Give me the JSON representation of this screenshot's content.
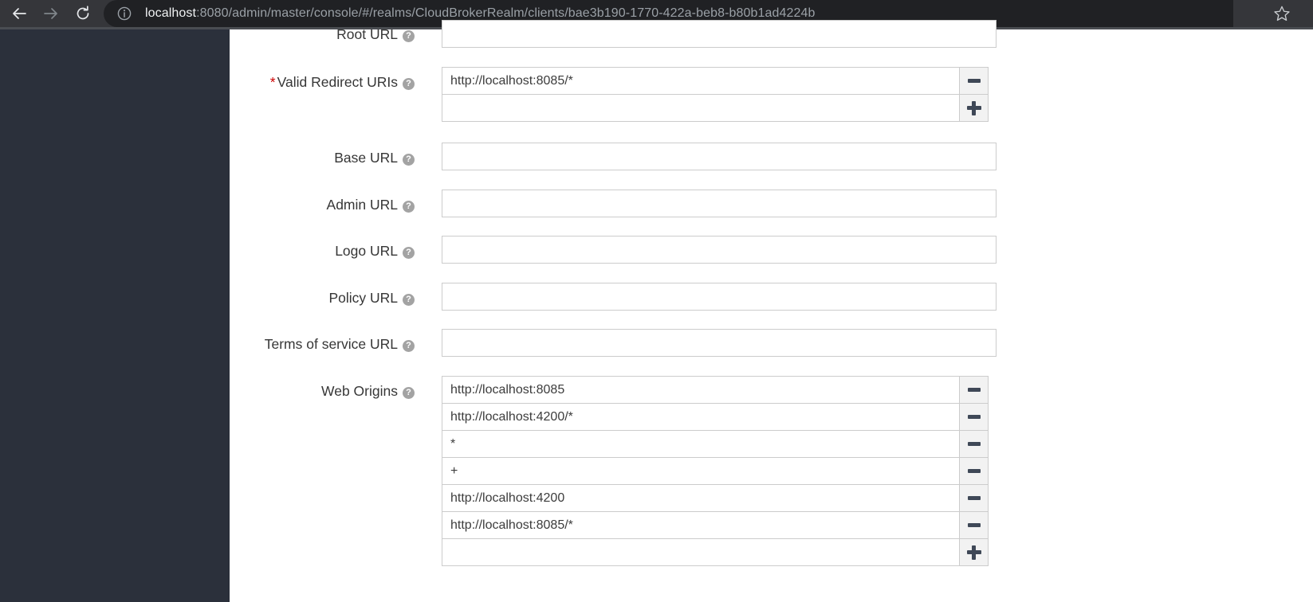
{
  "browser": {
    "back_icon": "back-arrow-icon",
    "forward_icon": "forward-arrow-icon",
    "reload_icon": "reload-icon",
    "info_icon": "info-circle-icon",
    "star_icon": "star-bookmark-icon",
    "url_host": "localhost",
    "url_rest": ":8080/admin/master/console/#/realms/CloudBrokerRealm/clients/bae3b190-1770-422a-beb8-b80b1ad4224b",
    "chrome_bg": "#35363a",
    "omnibox_bg": "#202124"
  },
  "theme": {
    "sidebar_bg": "#2b303b",
    "content_bg": "#ffffff",
    "label_color": "#363636",
    "required_color": "#cc0000",
    "input_border": "#cccccc",
    "button_bg": "#f2f2f2",
    "glyph_color": "#3f4857"
  },
  "form": {
    "help_glyph": "?",
    "required_glyph": "*",
    "minus_glyph": "minus-icon",
    "plus_glyph": "plus-icon",
    "fields": [
      {
        "id": "root-url",
        "label": "Root URL",
        "required": false,
        "type": "single",
        "value": "",
        "clipped": true
      },
      {
        "id": "valid-redirect-uris",
        "label": "Valid Redirect URIs",
        "required": true,
        "type": "multi",
        "values": [
          "http://localhost:8085/*",
          ""
        ]
      },
      {
        "id": "base-url",
        "label": "Base URL",
        "required": false,
        "type": "single",
        "value": ""
      },
      {
        "id": "admin-url",
        "label": "Admin URL",
        "required": false,
        "type": "single",
        "value": ""
      },
      {
        "id": "logo-url",
        "label": "Logo URL",
        "required": false,
        "type": "single",
        "value": ""
      },
      {
        "id": "policy-url",
        "label": "Policy URL",
        "required": false,
        "type": "single",
        "value": ""
      },
      {
        "id": "terms-of-service-url",
        "label": "Terms of service URL",
        "required": false,
        "type": "single",
        "value": ""
      },
      {
        "id": "web-origins",
        "label": "Web Origins",
        "required": false,
        "type": "multi",
        "values": [
          "http://localhost:8085",
          "http://localhost:4200/*",
          "*",
          "+",
          "http://localhost:4200",
          "http://localhost:8085/*",
          ""
        ]
      }
    ]
  }
}
